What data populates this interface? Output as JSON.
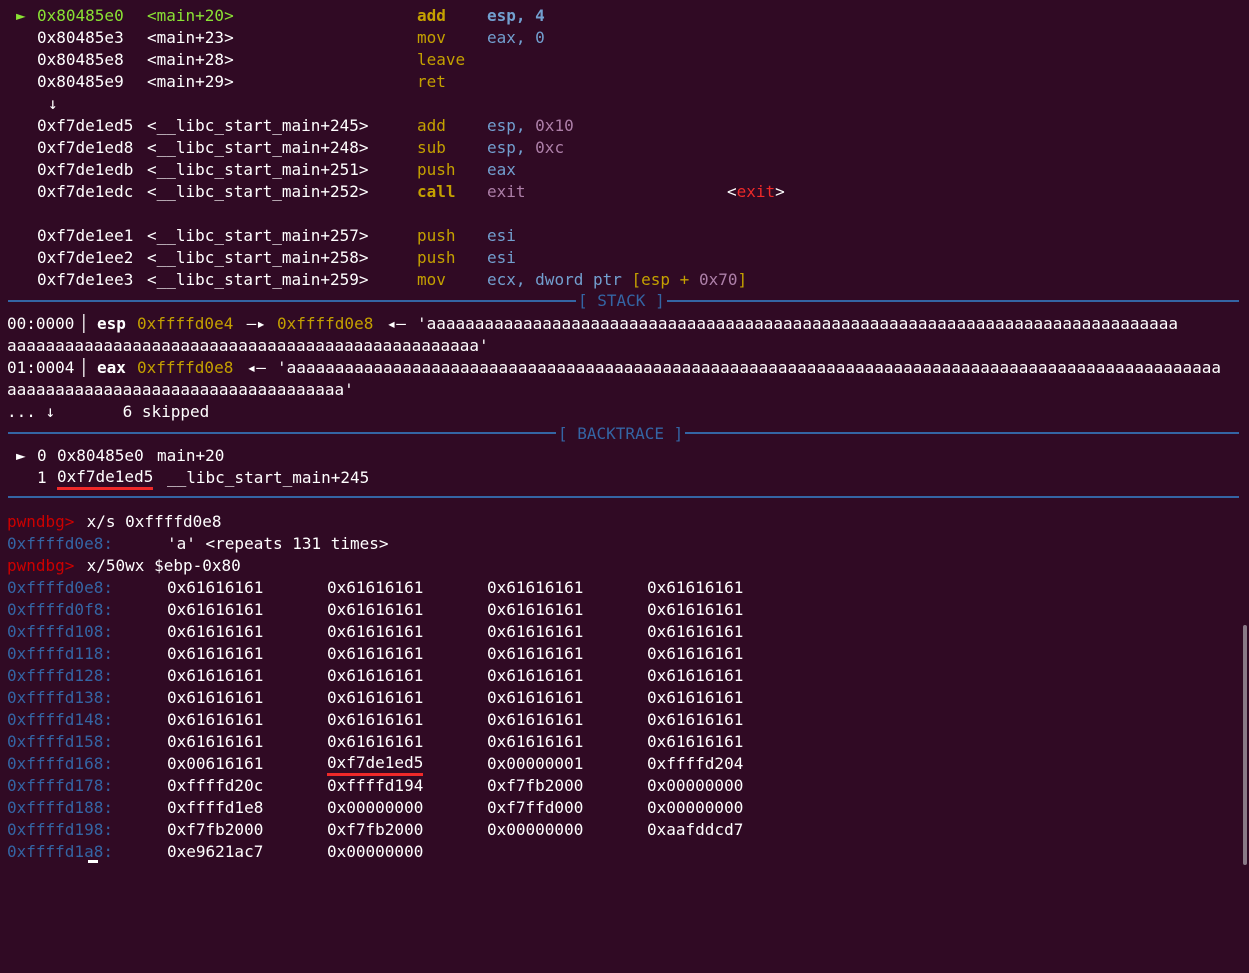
{
  "disasm": [
    {
      "marker": "►",
      "addr": "0x80485e0",
      "sym": "<main+20>",
      "mnem": "add",
      "ops": "esp, 4",
      "current": true
    },
    {
      "marker": "",
      "addr": "0x80485e3",
      "sym": "<main+23>",
      "mnem": "mov",
      "ops": "eax, 0"
    },
    {
      "marker": "",
      "addr": "0x80485e8",
      "sym": "<main+28>",
      "mnem": "leave",
      "ops": ""
    },
    {
      "marker": "",
      "addr": "0x80485e9",
      "sym": "<main+29>",
      "mnem": "ret",
      "ops": ""
    },
    {
      "arrow": "↓"
    },
    {
      "marker": "",
      "addr": "0xf7de1ed5",
      "sym": "<__libc_start_main+245>",
      "mnem": "add",
      "ops_reg": "esp, ",
      "ops_imm": "0x10"
    },
    {
      "marker": "",
      "addr": "0xf7de1ed8",
      "sym": "<__libc_start_main+248>",
      "mnem": "sub",
      "ops_reg": "esp, ",
      "ops_imm": "0xc"
    },
    {
      "marker": "",
      "addr": "0xf7de1edb",
      "sym": "<__libc_start_main+251>",
      "mnem": "push",
      "ops": "eax"
    },
    {
      "marker": "",
      "addr": "0xf7de1edc",
      "sym": "<__libc_start_main+252>",
      "mnem": "call",
      "ops": "exit",
      "target_open": "<",
      "target": "exit",
      "target_close": ">"
    },
    {
      "marker": "",
      "addr": "0xf7de1ee1",
      "sym": "<__libc_start_main+257>",
      "mnem": "push",
      "ops": "esi"
    },
    {
      "marker": "",
      "addr": "0xf7de1ee2",
      "sym": "<__libc_start_main+258>",
      "mnem": "push",
      "ops": "esi"
    },
    {
      "marker": "",
      "addr": "0xf7de1ee3",
      "sym": "<__libc_start_main+259>",
      "mnem": "mov",
      "ops_a": "ecx, ",
      "ops_b": "dword ptr",
      "ops_c": " [esp + ",
      "ops_d": "0x70",
      "ops_e": "]"
    }
  ],
  "stack_header": "[ STACK ]",
  "stack": [
    {
      "idx": "00:0000",
      "reg": "esp",
      "addr1": "0xffffd0e4",
      "arrow1": " —▸ ",
      "addr2": "0xffffd0e8",
      "arrow2": " ◂— ",
      "str1": "'aaaaaaaaaaaaaaaaaaaaaaaaaaaaaaaaaaaaaaaaaaaaaaaaaaaaaaaaaaaaaaaaaaaaaaaaaaaaaa",
      "str2": "aaaaaaaaaaaaaaaaaaaaaaaaaaaaaaaaaaaaaaaaaaaaaaaaa'"
    },
    {
      "idx": "01:0004",
      "reg": "eax",
      "addr1": "0xffffd0e8",
      "arrow1": " ◂— ",
      "str1": "'aaaaaaaaaaaaaaaaaaaaaaaaaaaaaaaaaaaaaaaaaaaaaaaaaaaaaaaaaaaaaaaaaaaaaaaaaaaaaaaaaaaaaaaaaaaaaaaaa",
      "str2": "aaaaaaaaaaaaaaaaaaaaaaaaaaaaaaaaaaa'"
    }
  ],
  "skipped": "... ↓       6 skipped",
  "backtrace_header": "[ BACKTRACE ]",
  "backtrace": [
    {
      "marker": "►",
      "num": "0",
      "addr": "0x80485e0",
      "sym": "main+20"
    },
    {
      "marker": "",
      "num": "1",
      "addr": "0xf7de1ed5",
      "sym": "__libc_start_main+245"
    }
  ],
  "console": {
    "prompt": "pwndbg>",
    "cmd1": " x/s 0xffffd0e8",
    "res1_addr": "0xffffd0e8:",
    "res1_val": "'a' <repeats 131 times>",
    "cmd2": " x/50wx $ebp-0x80"
  },
  "memory": [
    {
      "addr": "0xffffd0e8:",
      "words": [
        "0x61616161",
        "0x61616161",
        "0x61616161",
        "0x61616161"
      ]
    },
    {
      "addr": "0xffffd0f8:",
      "words": [
        "0x61616161",
        "0x61616161",
        "0x61616161",
        "0x61616161"
      ]
    },
    {
      "addr": "0xffffd108:",
      "words": [
        "0x61616161",
        "0x61616161",
        "0x61616161",
        "0x61616161"
      ]
    },
    {
      "addr": "0xffffd118:",
      "words": [
        "0x61616161",
        "0x61616161",
        "0x61616161",
        "0x61616161"
      ]
    },
    {
      "addr": "0xffffd128:",
      "words": [
        "0x61616161",
        "0x61616161",
        "0x61616161",
        "0x61616161"
      ]
    },
    {
      "addr": "0xffffd138:",
      "words": [
        "0x61616161",
        "0x61616161",
        "0x61616161",
        "0x61616161"
      ]
    },
    {
      "addr": "0xffffd148:",
      "words": [
        "0x61616161",
        "0x61616161",
        "0x61616161",
        "0x61616161"
      ]
    },
    {
      "addr": "0xffffd158:",
      "words": [
        "0x61616161",
        "0x61616161",
        "0x61616161",
        "0x61616161"
      ]
    },
    {
      "addr": "0xffffd168:",
      "words": [
        "0x00616161",
        "0xf7de1ed5",
        "0x00000001",
        "0xffffd204"
      ]
    },
    {
      "addr": "0xffffd178:",
      "words": [
        "0xffffd20c",
        "0xffffd194",
        "0xf7fb2000",
        "0x00000000"
      ]
    },
    {
      "addr": "0xffffd188:",
      "words": [
        "0xffffd1e8",
        "0x00000000",
        "0xf7ffd000",
        "0x00000000"
      ]
    },
    {
      "addr": "0xffffd198:",
      "words": [
        "0xf7fb2000",
        "0xf7fb2000",
        "0x00000000",
        "0xaafddcd7"
      ]
    },
    {
      "addr": "0xffffd1a8:",
      "words": [
        "0xe9621ac7",
        "0x00000000"
      ]
    }
  ],
  "colors": {
    "background": "#300a24",
    "green": "#8ae234",
    "yellow": "#c4a000",
    "blue": "#729fcf",
    "purple": "#ad7fa8",
    "rule": "#3465a4",
    "red": "#ef2929"
  }
}
